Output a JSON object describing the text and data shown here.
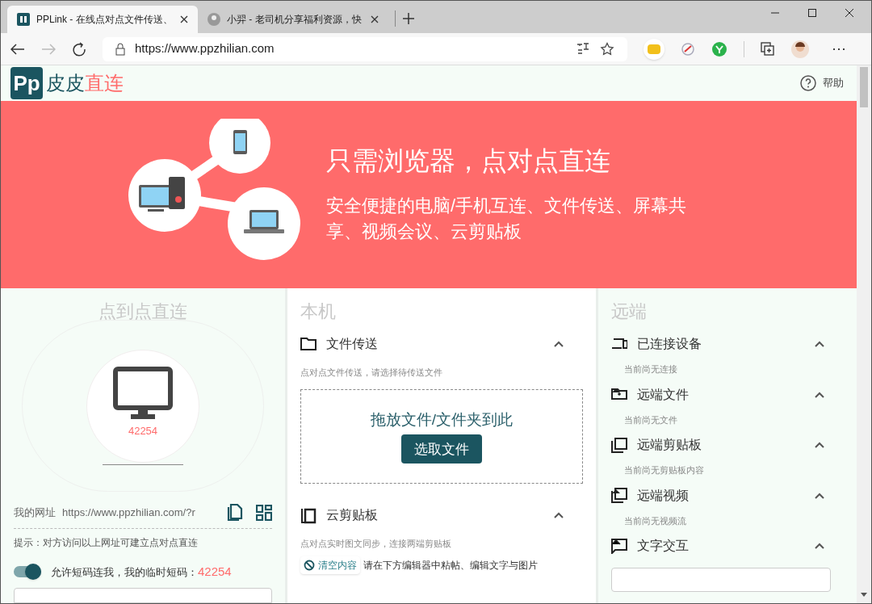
{
  "browser": {
    "tabs": [
      {
        "title": "PPLink - 在线点对点文件传送、",
        "selected": true,
        "kind": "logo"
      },
      {
        "title": "小羿 - 老司机分享福利资源，快",
        "selected": false,
        "kind": "avatar"
      }
    ],
    "address": "https://www.ppzhilian.com",
    "more": "⋯"
  },
  "header": {
    "logo_mark": "Pp",
    "brand_primary": "皮皮",
    "brand_accent": "直连",
    "help": "帮助"
  },
  "banner": {
    "headline": "只需浏览器，点对点直连",
    "subline": "安全便捷的电脑/手机互连、文件传送、屏幕共享、视频会议、云剪贴板"
  },
  "peer": {
    "title": "点到点直连",
    "device_code": "42254",
    "url_label": "我的网址",
    "url": "https://www.ppzhilian.com/?r",
    "hint": "提示：对方访问以上网址可建立点对点直连",
    "short_code": {
      "on": true,
      "label": "允许短码连我，我的临时短码：",
      "code": "42254"
    }
  },
  "local": {
    "title": "本机",
    "file_transfer": {
      "title": "文件传送",
      "expanded": true,
      "description": "点对点文件传送，请选择待传送文件",
      "drop_text": "拖放文件/文件夹到此",
      "button": "选取文件"
    },
    "clipboard": {
      "title": "云剪贴板",
      "expanded": true,
      "description": "点对点实时图文同步，连接两端剪贴板",
      "clear_button": "清空内容",
      "instruction": "请在下方编辑器中粘帖、编辑文字与图片"
    }
  },
  "remote": {
    "title": "远端",
    "sections": [
      {
        "kind": "devices",
        "title": "已连接设备",
        "expanded": true,
        "empty_text": "当前尚无连接"
      },
      {
        "kind": "folder",
        "title": "远端文件",
        "expanded": true,
        "empty_text": "当前尚无文件"
      },
      {
        "kind": "clipboard",
        "title": "远端剪贴板",
        "expanded": true,
        "empty_text": "当前尚无剪贴板内容"
      },
      {
        "kind": "video",
        "title": "远端视频",
        "expanded": true,
        "empty_text": "当前尚无视频流"
      },
      {
        "kind": "chat",
        "title": "文字交互",
        "expanded": true
      }
    ]
  }
}
